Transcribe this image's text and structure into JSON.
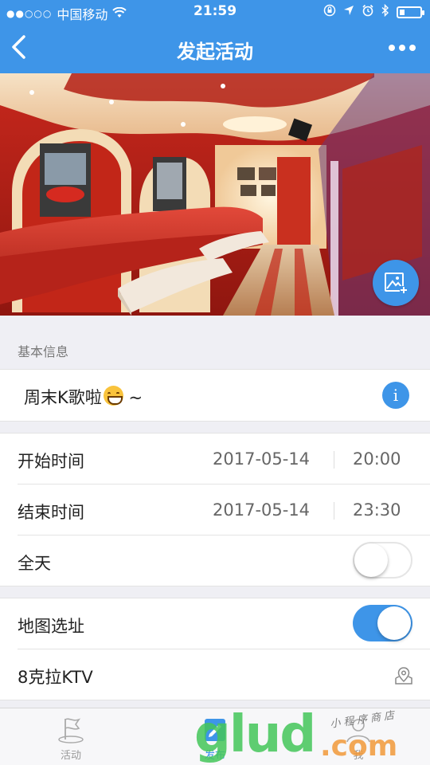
{
  "status": {
    "signal_dots": "●●○○○",
    "carrier": "中国移动",
    "time": "21:59"
  },
  "nav": {
    "title": "发起活动"
  },
  "basic_info": {
    "header": "基本信息",
    "activity_name": "周末K歌啦",
    "activity_name_suffix": " ~",
    "info_glyph": "i"
  },
  "schedule": {
    "start_label": "开始时间",
    "start_date": "2017-05-14",
    "start_time": "20:00",
    "end_label": "结束时间",
    "end_date": "2017-05-14",
    "end_time": "23:30",
    "all_day_label": "全天",
    "all_day": false
  },
  "location": {
    "map_label": "地图选址",
    "map_enabled": true,
    "place": "8克拉KTV"
  },
  "tabs": [
    {
      "label": "活动",
      "active": false
    },
    {
      "label": "发布",
      "active": true
    },
    {
      "label": "我",
      "active": false
    }
  ],
  "watermark": {
    "big": "glud",
    "small": "小程序商店",
    "com": ".com"
  },
  "colors": {
    "accent": "#3e95e8",
    "background": "#efeff4"
  }
}
